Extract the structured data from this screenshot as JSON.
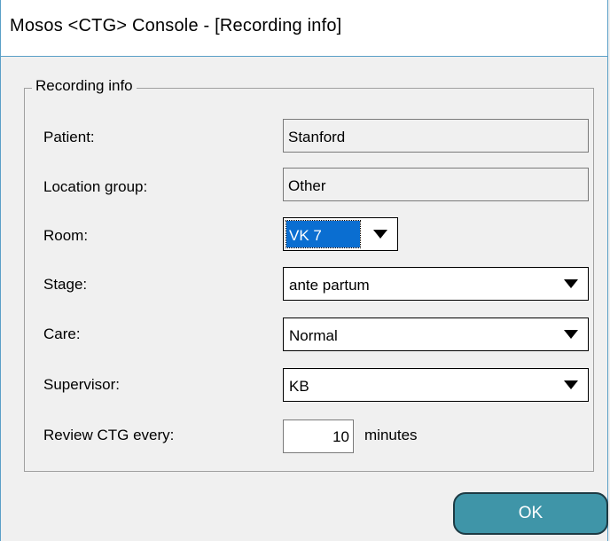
{
  "window": {
    "title": "Mosos <CTG> Console - [Recording info]"
  },
  "group": {
    "legend": "Recording info"
  },
  "fields": {
    "patient": {
      "label": "Patient:",
      "value": "Stanford"
    },
    "location_group": {
      "label": "Location group:",
      "value": "Other"
    },
    "room": {
      "label": "Room:",
      "value": "VK 7"
    },
    "stage": {
      "label": "Stage:",
      "value": "ante partum"
    },
    "care": {
      "label": "Care:",
      "value": "Normal"
    },
    "supervisor": {
      "label": "Supervisor:",
      "value": "KB"
    },
    "review": {
      "label": "Review CTG every:",
      "value": "10",
      "unit": "minutes"
    }
  },
  "buttons": {
    "ok": "OK"
  },
  "colors": {
    "accent": "#3f95a8",
    "selection": "#0a6ed1",
    "frame": "#5a9fc7"
  },
  "icons": {
    "dropdown": "chevron-down-icon"
  }
}
